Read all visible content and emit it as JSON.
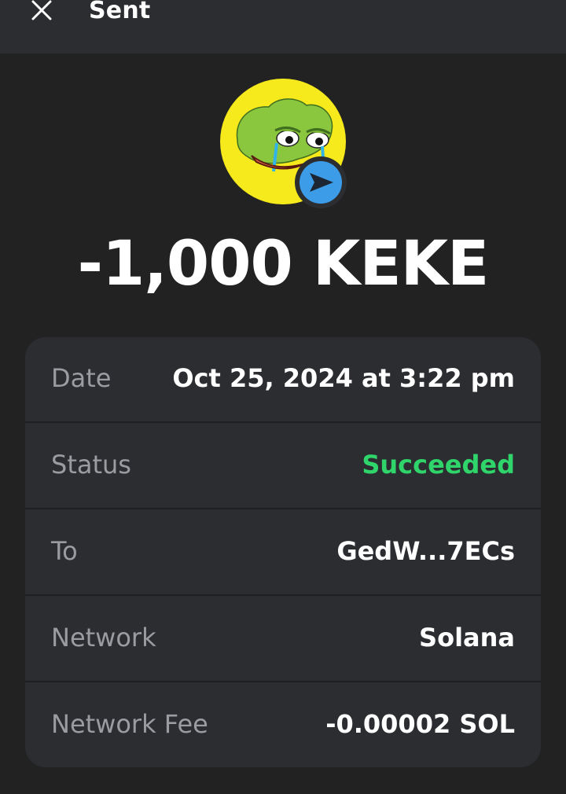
{
  "header": {
    "close_icon": "close-icon",
    "title": "Sent"
  },
  "token": {
    "icon": "keke-token-icon",
    "badge_icon": "send-arrow-icon",
    "amount": "-1,000 KEKE"
  },
  "details": {
    "rows": [
      {
        "label": "Date",
        "value": "Oct 25, 2024 at 3:22 pm"
      },
      {
        "label": "Status",
        "value": "Succeeded"
      },
      {
        "label": "To",
        "value": "GedW...7ECs"
      },
      {
        "label": "Network",
        "value": "Solana"
      },
      {
        "label": "Network Fee",
        "value": "-0.00002 SOL"
      }
    ]
  },
  "colors": {
    "background": "#222222",
    "header_background": "#2c2d30",
    "card_background": "#2c2d31",
    "status_success": "#2fd46a",
    "badge_blue": "#3d9ce8",
    "token_yellow": "#f6ea1c"
  }
}
